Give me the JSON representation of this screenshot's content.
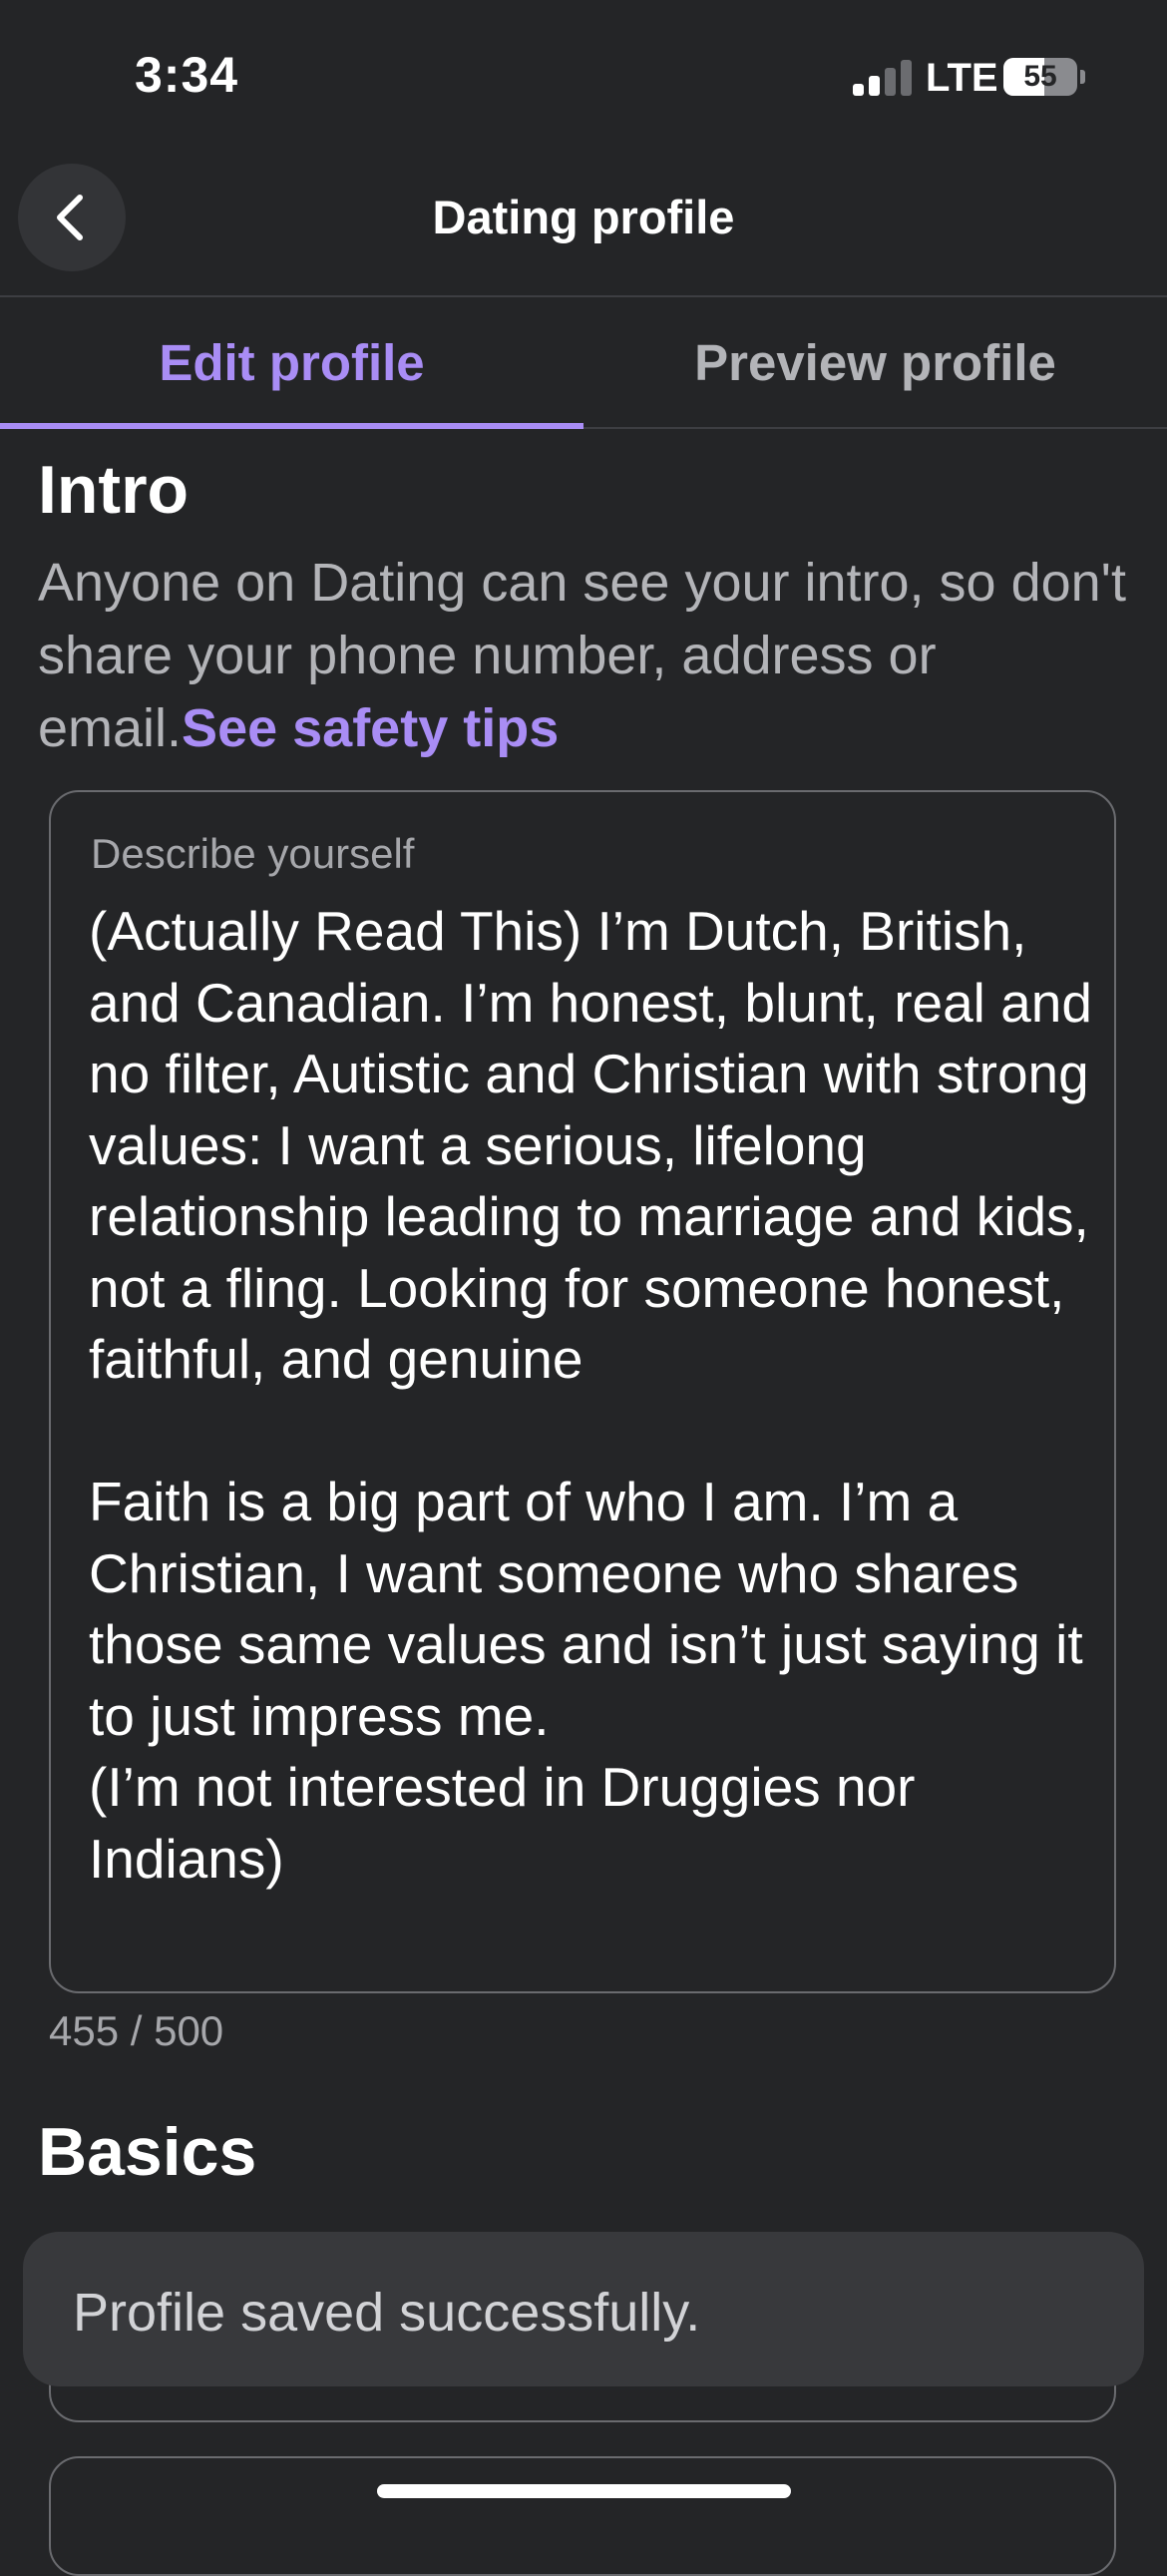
{
  "status_bar": {
    "time": "3:34",
    "network": "LTE",
    "battery_level": "55",
    "battery_fraction": 0.55,
    "signal_bars_active": 2,
    "signal_bars_total": 4
  },
  "nav": {
    "title": "Dating profile",
    "back_icon": "chevron-left-icon"
  },
  "tabs": [
    {
      "label": "Edit profile",
      "active": true
    },
    {
      "label": "Preview profile",
      "active": false
    }
  ],
  "intro": {
    "heading": "Intro",
    "description": "Anyone on Dating can see your intro, so don't share your phone number, address or email.",
    "safety_link": "See safety tips",
    "field_label": "Describe yourself",
    "field_value": "(Actually Read This) I’m Dutch, British, and Canadian. I’m honest, blunt, real and no filter, Autistic and Christian with strong values: I want a serious, lifelong relationship leading to marriage and kids, not a fling. Looking for someone honest, faithful, and genuine\n\nFaith is a big part of who I am. I’m a Christian, I want someone who shares those same values and isn’t just saying it to just impress me.\n(I’m not interested in Druggies nor Indians)",
    "char_count": "455 / 500"
  },
  "basics": {
    "heading": "Basics"
  },
  "toast": {
    "message": "Profile saved successfully."
  },
  "colors": {
    "background": "#242527",
    "accent": "#a98df5",
    "muted_text": "#b3b4b8",
    "toast_bg": "#38393c"
  }
}
